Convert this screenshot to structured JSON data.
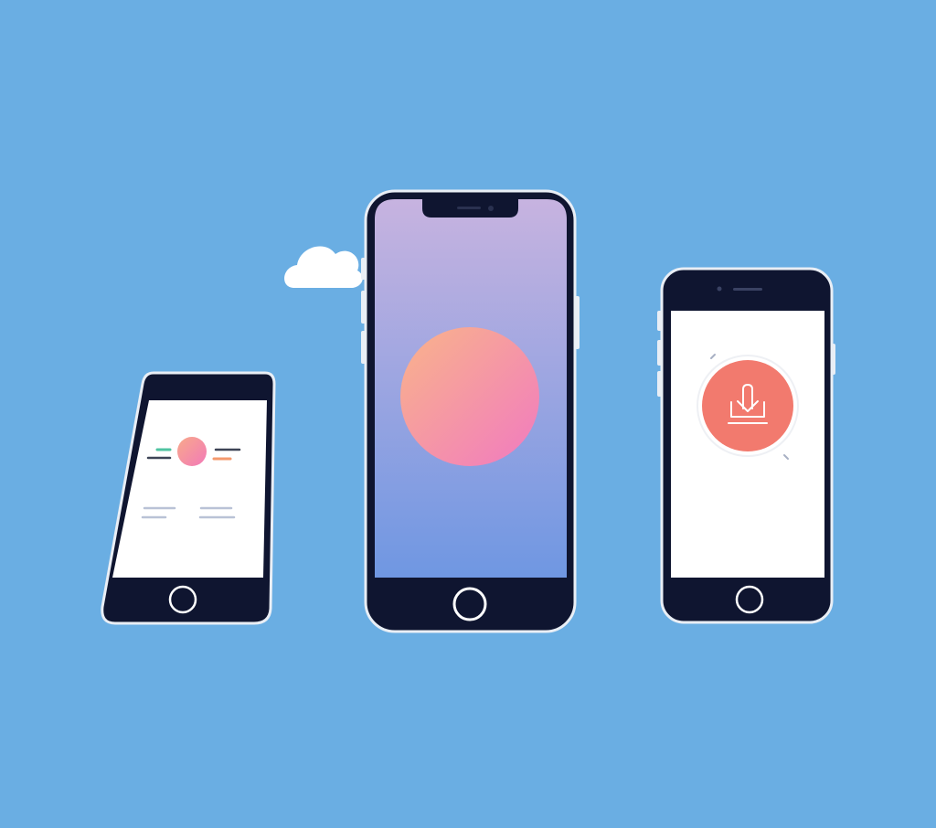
{
  "scene": {
    "background_color": "#6aaee3",
    "description_icons": [
      "cloud-icon",
      "download-icon"
    ]
  },
  "colors": {
    "phone_body": "#0f1530",
    "phone_bezel_edge": "#e9eef5",
    "screen_white": "#ffffff",
    "gradient_top": "#c7b3e0",
    "gradient_bottom": "#6f97e2",
    "orb_start": "#f9a98a",
    "orb_end": "#f27ab8",
    "download_badge": "#f27a6e",
    "accent_green": "#4fc3a1",
    "accent_orange": "#f4996d",
    "line_gray": "#b9c2d6"
  },
  "phones": {
    "left": {
      "screen": "list-with-orb"
    },
    "center": {
      "screen": "gradient-orb"
    },
    "right": {
      "screen": "download-prompt"
    }
  }
}
